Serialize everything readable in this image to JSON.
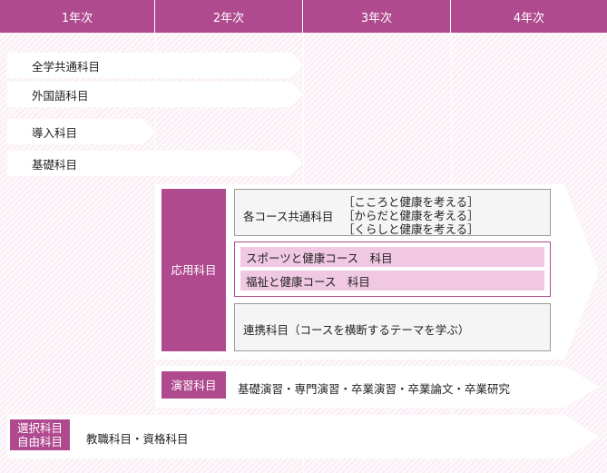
{
  "header": {
    "years": [
      "1年次",
      "2年次",
      "3年次",
      "4年次"
    ]
  },
  "rows": {
    "zengaku": "全学共通科目",
    "gaikokugo": "外国語科目",
    "dounyu": "導入科目",
    "kiso": "基礎科目"
  },
  "ouyou": {
    "label": "応用科目",
    "course_common": {
      "label": "各コース共通科目",
      "items": [
        "［こころと健康を考える］",
        "［からだと健康を考える］",
        "［くらしと健康を考える］"
      ]
    },
    "courses": [
      "スポーツと健康コース　科目",
      "福祉と健康コース　科目"
    ],
    "renkei": "連携科目（コースを横断するテーマを学ぶ）"
  },
  "enshu": {
    "label": "演習科目",
    "text": "基礎演習・専門演習・卒業演習・卒業論文・卒業研究"
  },
  "sentaku": {
    "label_line1": "選択科目",
    "label_line2": "自由科目",
    "text": "教職科目・資格科目"
  },
  "colors": {
    "accent": "#b04a8f",
    "light_pink": "#f0c8e2",
    "box_gray": "#f5f5f5"
  }
}
